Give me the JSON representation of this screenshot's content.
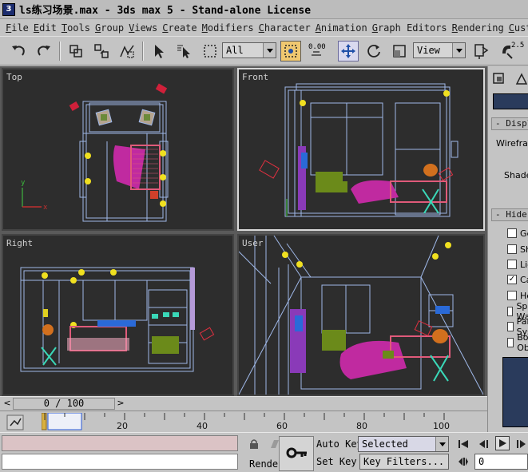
{
  "window": {
    "title": "ls练习场景.max - 3ds max 5 - Stand-alone License",
    "app_icon": "3ds-max-icon"
  },
  "menu": {
    "items": [
      "File",
      "Edit",
      "Tools",
      "Group",
      "Views",
      "Create",
      "Modifiers",
      "Character",
      "Animation",
      "Graph Editors",
      "Rendering",
      "Customize"
    ]
  },
  "toolbar": {
    "selection_filter": "All",
    "reference_coord": "View",
    "snap_label": "0.00",
    "angle_snap_label": "2.5",
    "icons": [
      "undo-icon",
      "redo-icon",
      "link-icon",
      "unlink-icon",
      "bind-space-warp-icon",
      "select-icon",
      "select-by-name-icon",
      "rectangular-region-icon",
      "window-crossing-icon",
      "spinner-snap-icon",
      "move-icon",
      "rotate-icon",
      "scale-icon",
      "pivot-icon",
      "mirror-icon",
      "snap-toggle-icon"
    ]
  },
  "viewports": {
    "top": "Top",
    "front": "Front",
    "right": "Right",
    "user": "User"
  },
  "command_panel": {
    "rollout_display_color": "Display Color",
    "wireframe_label": "Wireframe",
    "shaded_label": "Shaded",
    "rollout_hide": "Hide by Category",
    "hide_items": [
      {
        "label": "Geometry",
        "checked": false
      },
      {
        "label": "Shapes",
        "checked": false
      },
      {
        "label": "Lights",
        "checked": false
      },
      {
        "label": "Cameras",
        "checked": true
      },
      {
        "label": "Helpers",
        "checked": false
      },
      {
        "label": "Space Warps",
        "checked": false
      },
      {
        "label": "Particle Systems",
        "checked": false
      },
      {
        "label": "Bone Objects",
        "checked": false
      }
    ]
  },
  "time_slider": {
    "label": "0 / 100",
    "prev": "<",
    "next": ">"
  },
  "track_bar": {
    "ticks": [
      "20",
      "40",
      "60",
      "80",
      "100"
    ]
  },
  "status": {
    "render_label": "Rende",
    "auto_key": "Auto Key",
    "set_key": "Set Key",
    "key_mode": "Selected",
    "key_filters": "Key Filters...",
    "current_frame": "0"
  }
}
